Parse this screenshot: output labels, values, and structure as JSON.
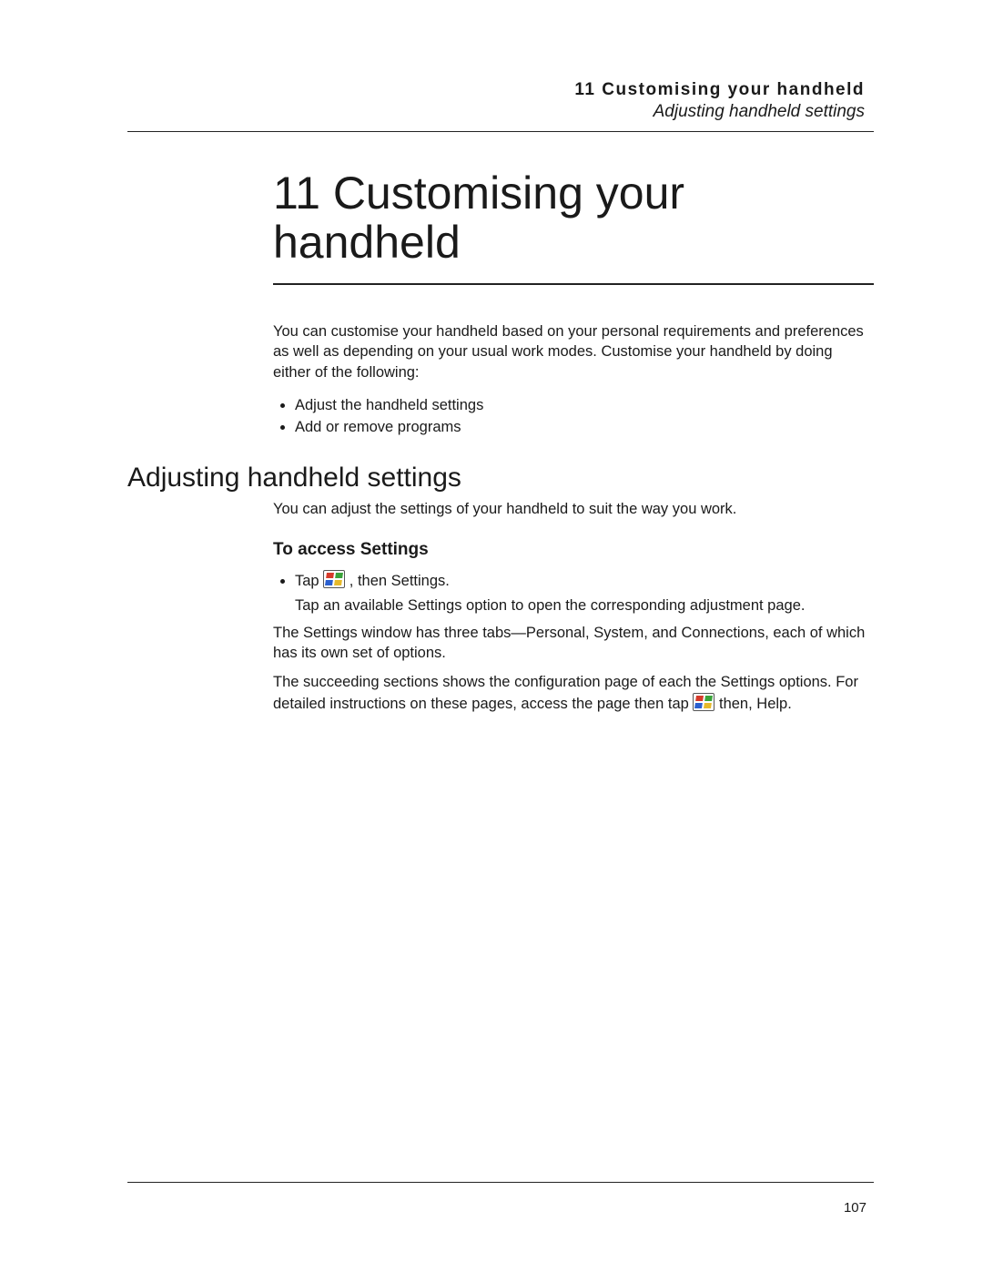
{
  "runningHeader": {
    "chapterNum": "11",
    "chapterTitle": "Customising your handheld",
    "sectionTitle": "Adjusting handheld settings"
  },
  "chapter": {
    "number": "11",
    "title": "Customising your handheld"
  },
  "intro": {
    "paragraph": "You can customise your handheld based on your personal requirements and preferences as well as depending on your usual work modes. Customise your handheld by doing either of the following:",
    "bullets": [
      "Adjust the handheld settings",
      "Add or remove programs"
    ]
  },
  "section": {
    "heading": "Adjusting handheld settings",
    "lead": "You can adjust the settings of your handheld to suit the way you work.",
    "subheading": "To access Settings",
    "tapBullet": {
      "pre": "Tap ",
      "post": " , then Settings."
    },
    "tapFollow": "Tap an available Settings option to open the corresponding adjustment page.",
    "tabsParagraph": "The Settings window has three tabs—Personal, System, and Connections, each of which has its own set of options.",
    "succeeding": {
      "pre": "The succeeding sections shows the configuration page of each the Settings options. For detailed instructions on these pages, access the page then tap ",
      "post": " then, Help."
    }
  },
  "pageNumber": "107"
}
